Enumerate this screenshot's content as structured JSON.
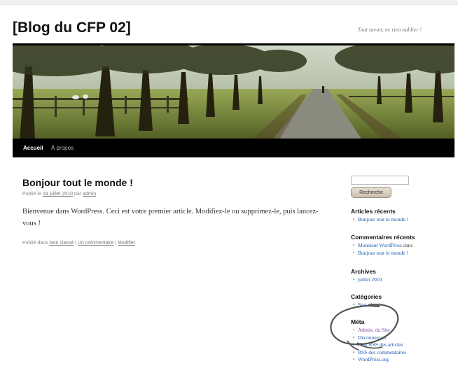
{
  "site": {
    "title": "[Blog du CFP 02]",
    "tagline": "Tout savoir, ne rien oublier !"
  },
  "nav": {
    "home": "Accueil",
    "about": "À propos"
  },
  "post": {
    "title": "Bonjour tout le monde !",
    "meta_prefix": "Publié le",
    "date": "19 juillet 2010",
    "by": "par",
    "author": "admin",
    "body": "Bienvenue dans WordPress. Ceci est votre premier article. Modifiez-le ou supprimez-le, puis lancez-vous !",
    "foot_prefix": "Publié dans",
    "category": "Non classé",
    "sep1": "|",
    "comment": "Un commentaire",
    "sep2": "|",
    "edit": "Modifier"
  },
  "sidebar": {
    "search": {
      "placeholder": "",
      "button": "Recherche"
    },
    "recent_posts": {
      "title": "Articles récents",
      "items": [
        "Bonjour tout le monde !"
      ]
    },
    "recent_comments": {
      "title": "Commentaires récents",
      "author": "Monsieur WordPress",
      "on": "dans",
      "post": "Bonjour tout le monde !"
    },
    "archives": {
      "title": "Archives",
      "items": [
        "juillet 2010"
      ]
    },
    "categories": {
      "title": "Catégories",
      "items": [
        "Non classé"
      ]
    },
    "meta": {
      "title": "Méta",
      "items": [
        "Admin. du Site",
        "Déconnexion",
        "Flux RSS des articles",
        "RSS des commentaires",
        "WordPress.org"
      ]
    }
  },
  "colors": {
    "link": "#1b57b1",
    "visited": "#7b3fa0",
    "nav_bg": "#000000"
  }
}
